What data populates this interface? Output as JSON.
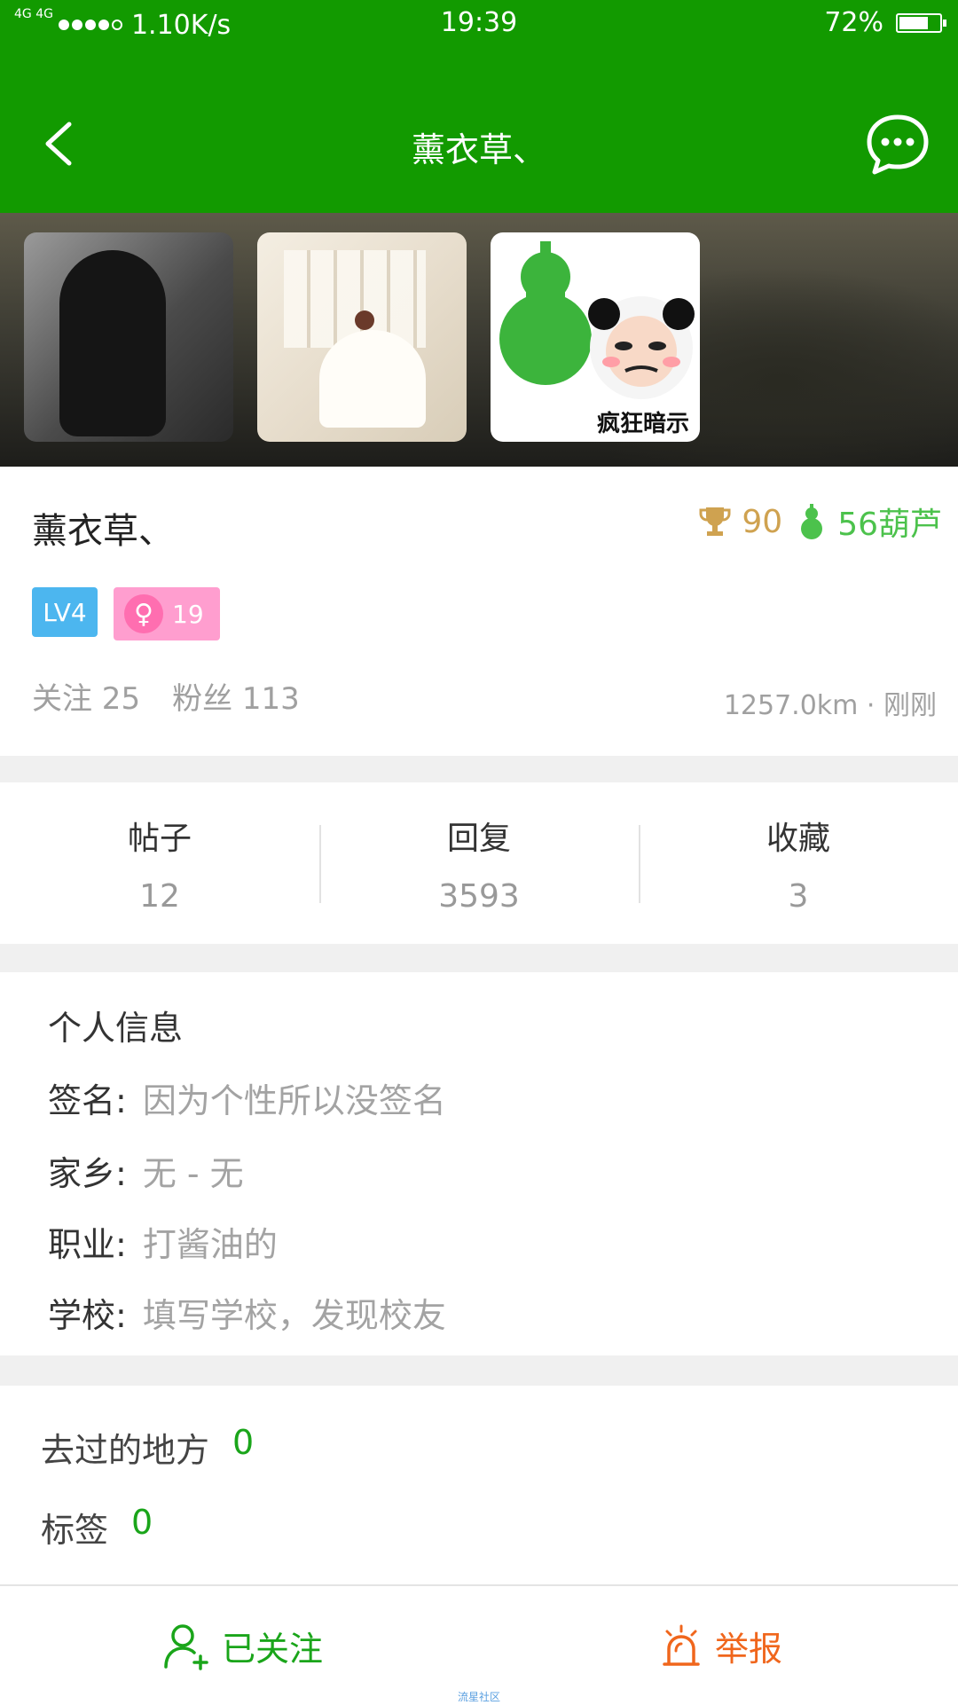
{
  "status_bar": {
    "network": "4G 4G",
    "speed": "1.10K/s",
    "time": "19:39",
    "battery": "72%",
    "battery_level": 0.72
  },
  "nav": {
    "title": "薰衣草、"
  },
  "photos": [
    {
      "caption": ""
    },
    {
      "caption": ""
    },
    {
      "caption": "疯狂暗示"
    }
  ],
  "profile": {
    "name": "薰衣草、",
    "trophy_count": "90",
    "gourd_count": "56葫芦",
    "level": "LV4",
    "gender_symbol": "♀",
    "age": "19",
    "following": "关注 25",
    "fans": "粉丝 113",
    "location_time": "1257.0km · 刚刚"
  },
  "counts": [
    {
      "label": "帖子",
      "value": "12"
    },
    {
      "label": "回复",
      "value": "3593"
    },
    {
      "label": "收藏",
      "value": "3"
    }
  ],
  "personal_info": {
    "title": "个人信息",
    "rows": [
      {
        "label": "签名:",
        "value": "因为个性所以没签名"
      },
      {
        "label": "家乡:",
        "value": "无 - 无"
      },
      {
        "label": "职业:",
        "value": "打酱油的"
      },
      {
        "label": "学校:",
        "value": "填写学校，发现校友"
      }
    ]
  },
  "places": {
    "label": "去过的地方",
    "count": "0"
  },
  "tags": {
    "label": "标签",
    "count": "0"
  },
  "bottom": {
    "followed_label": "已关注",
    "report_label": "举报",
    "watermark": "流星社区"
  },
  "colors": {
    "header_green": "#129a00",
    "accent_green": "#1aa51a",
    "trophy_gold": "#cfa250",
    "level_blue": "#4cb6ef",
    "female_pink": "#ff9ecf",
    "report_orange": "#f0661c"
  }
}
